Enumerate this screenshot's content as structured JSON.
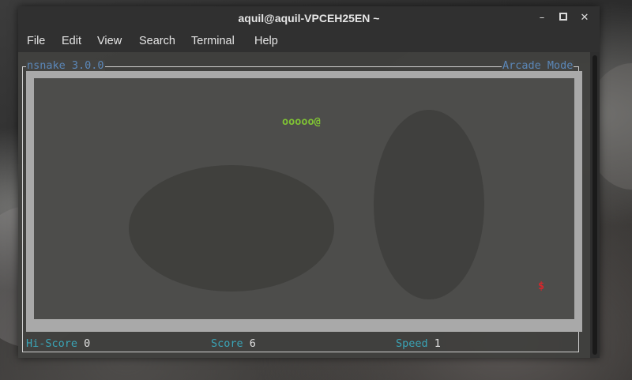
{
  "window": {
    "title": "aquil@aquil-VPCEH25EN ~",
    "controls": {
      "minimize": "–",
      "close": "✕"
    }
  },
  "menu": [
    "File",
    "Edit",
    "View",
    "Search",
    "Terminal",
    "Help"
  ],
  "game": {
    "app_label": "nsnake 3.0.0",
    "mode_label": "Arcade Mode",
    "snake": "ooooo@",
    "food": "$",
    "status": {
      "hiscore_label": "Hi-Score",
      "hiscore_value": "0",
      "score_label": "Score",
      "score_value": "6",
      "speed_label": "Speed",
      "speed_value": "1"
    }
  },
  "colors": {
    "snake": "#7fc234",
    "food": "#d7262b",
    "frame_label": "#5b87b8",
    "status_label": "#3aa4b6"
  }
}
